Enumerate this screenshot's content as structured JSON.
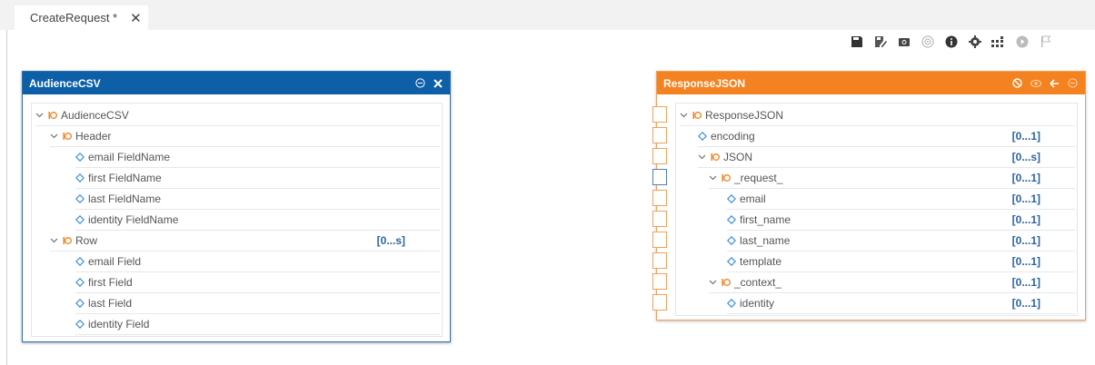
{
  "tab": {
    "label": "CreateRequest *",
    "close": "✕"
  },
  "toolbar": [
    "save-icon",
    "save-as-icon",
    "camera-icon",
    "target-icon",
    "info-icon",
    "settings-icon",
    "mapping-icon",
    "play-icon",
    "flag-icon"
  ],
  "left_panel": {
    "title": "AudienceCSV",
    "rows": [
      {
        "label": "AudienceCSV",
        "type": "group",
        "expanded": true,
        "cardinality": ""
      },
      {
        "label": "Header",
        "type": "group",
        "expanded": true,
        "cardinality": ""
      },
      {
        "label": "email FieldName",
        "type": "field",
        "cardinality": ""
      },
      {
        "label": "first FieldName",
        "type": "field",
        "cardinality": ""
      },
      {
        "label": "last FieldName",
        "type": "field",
        "cardinality": ""
      },
      {
        "label": "identity FieldName",
        "type": "field",
        "cardinality": ""
      },
      {
        "label": "Row",
        "type": "group",
        "expanded": true,
        "cardinality": "[0...s]"
      },
      {
        "label": "email Field",
        "type": "field",
        "cardinality": ""
      },
      {
        "label": "first Field",
        "type": "field",
        "cardinality": ""
      },
      {
        "label": "last Field",
        "type": "field",
        "cardinality": ""
      },
      {
        "label": "identity Field",
        "type": "field",
        "cardinality": ""
      }
    ]
  },
  "right_panel": {
    "title": "ResponseJSON",
    "rows": [
      {
        "label": "ResponseJSON",
        "type": "group",
        "expanded": true,
        "cardinality": ""
      },
      {
        "label": "encoding",
        "type": "field",
        "cardinality": "[0...1]"
      },
      {
        "label": "JSON",
        "type": "group",
        "expanded": true,
        "cardinality": "[0...s]"
      },
      {
        "label": "_request_",
        "type": "group",
        "expanded": true,
        "cardinality": "[0...1]"
      },
      {
        "label": "email",
        "type": "field",
        "cardinality": "[0...1]"
      },
      {
        "label": "first_name",
        "type": "field",
        "cardinality": "[0...1]"
      },
      {
        "label": "last_name",
        "type": "field",
        "cardinality": "[0...1]"
      },
      {
        "label": "template",
        "type": "field",
        "cardinality": "[0...1]"
      },
      {
        "label": "_context_",
        "type": "group",
        "expanded": true,
        "cardinality": "[0...1]"
      },
      {
        "label": "identity",
        "type": "field",
        "cardinality": "[0...1]"
      }
    ]
  },
  "colors": {
    "left_header": "#0d5fa8",
    "right_header": "#f58220",
    "cardinality": "#2a63a5",
    "field_icon": "#3b8de0",
    "group_icon": "#f58220"
  }
}
